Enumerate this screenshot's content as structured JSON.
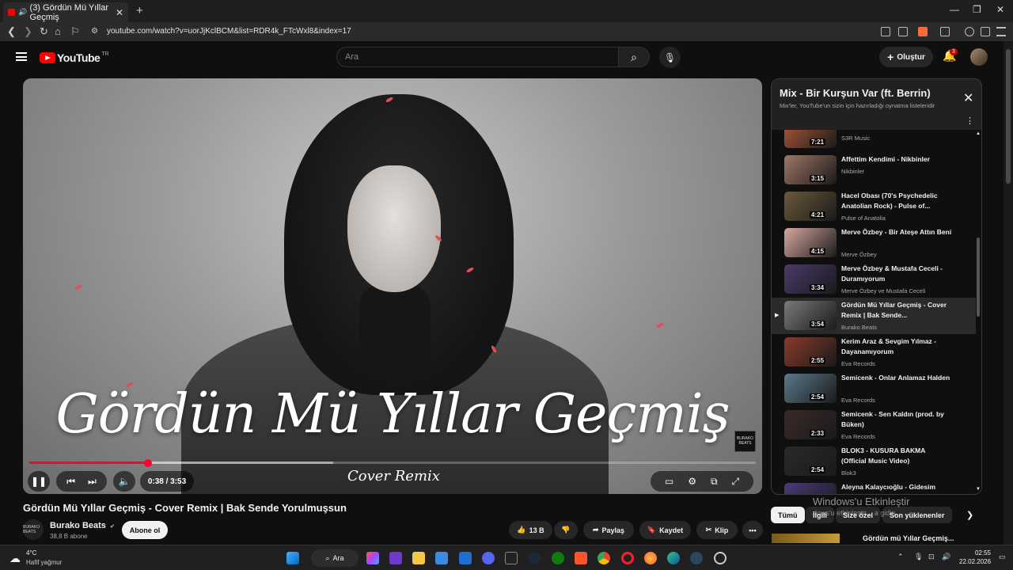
{
  "browser": {
    "tab_title": "(3) Gördün Mü Yıllar Geçmiş",
    "url": "youtube.com/watch?v=uorJjKclBCM&list=RDR4k_FTcWxl8&index=17"
  },
  "header": {
    "logo_text": "YouTube",
    "region": "TR",
    "search_placeholder": "Ara",
    "create_label": "Oluştur",
    "notif_count": "3"
  },
  "player": {
    "overlay_title": "Gördün Mü Yıllar Geçmiş",
    "overlay_subtitle": "Cover Remix",
    "watermark": "BURAKO BEATS",
    "time": "0:38 / 3:53",
    "progress": 0.163,
    "buffered": 0.418
  },
  "video": {
    "title": "Gördün Mü Yıllar Geçmiş - Cover Remix | Bak Sende Yorulmuşsun",
    "channel": "Burako Beats",
    "verified": "✔",
    "subscribers": "38,8 B abone",
    "subscribe_label": "Abone ol",
    "likes": "13 B",
    "share_label": "Paylaş",
    "save_label": "Kaydet",
    "clip_label": "Klip",
    "channel_avatar_text": "BURAKO BEATS"
  },
  "playlist": {
    "title": "Mix - Bir Kurşun Var (ft. Berrin)",
    "description": "Mix'ler, YouTube'un sizin için hazırladığı oynatma listeleridir",
    "items": [
      {
        "title": "",
        "channel": "S3R Music",
        "duration": "7:21",
        "color": "#b05a3a"
      },
      {
        "title": "Affettim Kendimi - Nikbinler",
        "channel": "Nikbinler",
        "duration": "3:15",
        "color": "#a07868"
      },
      {
        "title": "Hacel Obası (70's Psychedelic Anatolian Rock) - Pulse of...",
        "channel": "Pulse of Anatolia",
        "duration": "4:21",
        "color": "#6b5a3a"
      },
      {
        "title": "Merve Özbey - Bir Ateşe Attın Beni",
        "channel": "Merve Özbey",
        "duration": "4:15",
        "color": "#d8a8a0"
      },
      {
        "title": "Merve Özbey & Mustafa Ceceli - Duramıyorum",
        "channel": "Merve Özbey ve Mustafa Ceceli",
        "duration": "3:34",
        "color": "#4a3a6a"
      },
      {
        "title": "Gördün Mü Yıllar Geçmiş - Cover Remix | Bak Sende...",
        "channel": "Burako Beats",
        "duration": "3:54",
        "color": "#7a7a7a",
        "active": true
      },
      {
        "title": "Kerim Araz & Sevgim Yılmaz - Dayanamıyorum",
        "channel": "Eva Records",
        "duration": "2:55",
        "color": "#8a3a2a"
      },
      {
        "title": "Semicenk - Onlar Anlamaz Halden",
        "channel": "Eva Records",
        "duration": "2:54",
        "color": "#5a7a8a"
      },
      {
        "title": "Semicenk - Sen Kaldın (prod. by Büken)",
        "channel": "Eva Records",
        "duration": "2:33",
        "color": "#3a2a2a"
      },
      {
        "title": "BLOK3 - KUSURA BAKMA (Official Music Video)",
        "channel": "Blok3",
        "duration": "2:54",
        "color": "#2a2a2a"
      },
      {
        "title": "Aleyna Kalaycıoğlu - Gidesim",
        "channel": "",
        "duration": "",
        "color": "#4a3a7a"
      }
    ]
  },
  "chips": [
    "Tümü",
    "İlgili",
    "Size özel",
    "Son yüklenenler"
  ],
  "watermark_text": {
    "line1": "Windows'u Etkinleştir",
    "line2": "dows'u etkinleştir... a gidin."
  },
  "recommended": {
    "title": "Gördün mü Yıllar Geçmiş..."
  },
  "taskbar": {
    "temperature": "4°C",
    "weather": "Hafif yağmur",
    "search_label": "Ara",
    "time": "02:55",
    "date": "22.02.2026"
  }
}
